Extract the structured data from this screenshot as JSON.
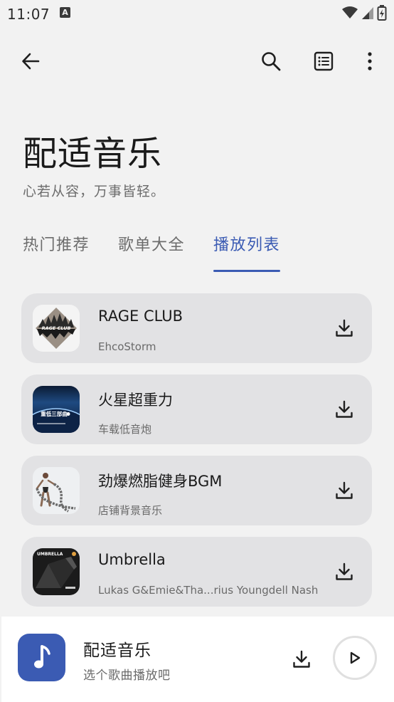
{
  "status_bar": {
    "time": "11:07",
    "notification_badge": "A",
    "icons": [
      "wifi-icon",
      "signal-icon",
      "battery-charging-icon"
    ]
  },
  "toolbar": {
    "back_icon": "arrow-left-icon",
    "search_icon": "search-icon",
    "list_icon": "list-view-icon",
    "more_icon": "more-vertical-icon"
  },
  "header": {
    "title": "配适音乐",
    "subtitle": "心若从容，万事皆轻。"
  },
  "tabs": [
    {
      "label": "热门推荐",
      "active": false
    },
    {
      "label": "歌单大全",
      "active": false
    },
    {
      "label": "播放列表",
      "active": true
    }
  ],
  "songs": [
    {
      "title": "RAGE CLUB",
      "artist": "EhcoStorm"
    },
    {
      "title": "火星超重力",
      "artist": "车载低音炮"
    },
    {
      "title": "劲爆燃脂健身BGM",
      "artist": "店铺背景音乐"
    },
    {
      "title": "Umbrella",
      "artist": "Lukas G&Emie&Tha...rius Youngdell Nash"
    }
  ],
  "cover_texts": {
    "rage_club": "RAGE CLUB",
    "mars": "重低三部曲",
    "umbrella": "UMBRELLA"
  },
  "player": {
    "title": "配适音乐",
    "subtitle": "选个歌曲播放吧",
    "cover_icon": "music-note-icon"
  },
  "colors": {
    "accent": "#3b5bb3",
    "background": "#f2f2f2",
    "card": "#e2e2e4"
  }
}
